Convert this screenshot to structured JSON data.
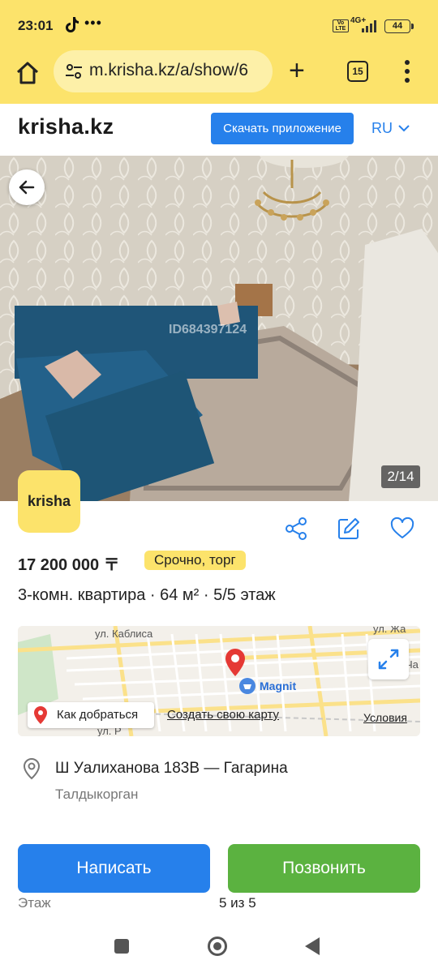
{
  "status_bar": {
    "time": "23:01",
    "tiktok_icon": "tiktok-icon",
    "more": "•••",
    "net_badge": "Vo LTE",
    "network": "4G+",
    "battery": "44"
  },
  "browser": {
    "url": "m.krisha.kz/a/show/6",
    "tabs_count": "15"
  },
  "site": {
    "logo": "krisha.kz",
    "download_button": "Скачать приложение",
    "language": "RU"
  },
  "gallery": {
    "counter": "2/14",
    "watermark": "ID684397124"
  },
  "badge": {
    "label": "krisha"
  },
  "listing": {
    "price": "17 200 000 〒",
    "tag": "Срочно, торг",
    "title": "3-комн. квартира · 64 м² · 5/5 этаж",
    "address": "Ш Уалиханова 183В — Гагарина",
    "city": "Талдыкорган"
  },
  "map": {
    "directions_label": "Как добраться",
    "create_map_label": "Создать свою карту",
    "terms_label": "Условия",
    "poi": "Magnit",
    "street_1": "ул. Каблиса",
    "street_2": "ул. Жа",
    "street_3": "Ча",
    "street_4": "ул. Р"
  },
  "actions": {
    "write": "Написать",
    "call": "Позвонить"
  },
  "details": {
    "floor_label": "Этаж",
    "floor_value": "5 из 5"
  },
  "colors": {
    "brand_yellow": "#fce36b",
    "primary_blue": "#2680eb",
    "call_green": "#5bb240"
  }
}
